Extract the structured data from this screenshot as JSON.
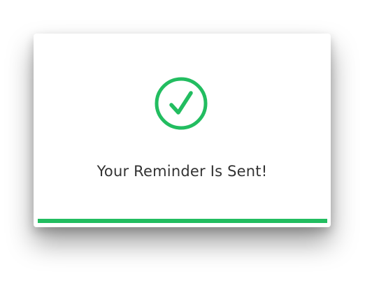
{
  "dialog": {
    "message": "Your Reminder Is Sent!",
    "icon": "checkmark-circle-icon",
    "progress": 1.0
  },
  "colors": {
    "accent": "#22bd60",
    "text": "#333333",
    "background": "#ffffff"
  }
}
